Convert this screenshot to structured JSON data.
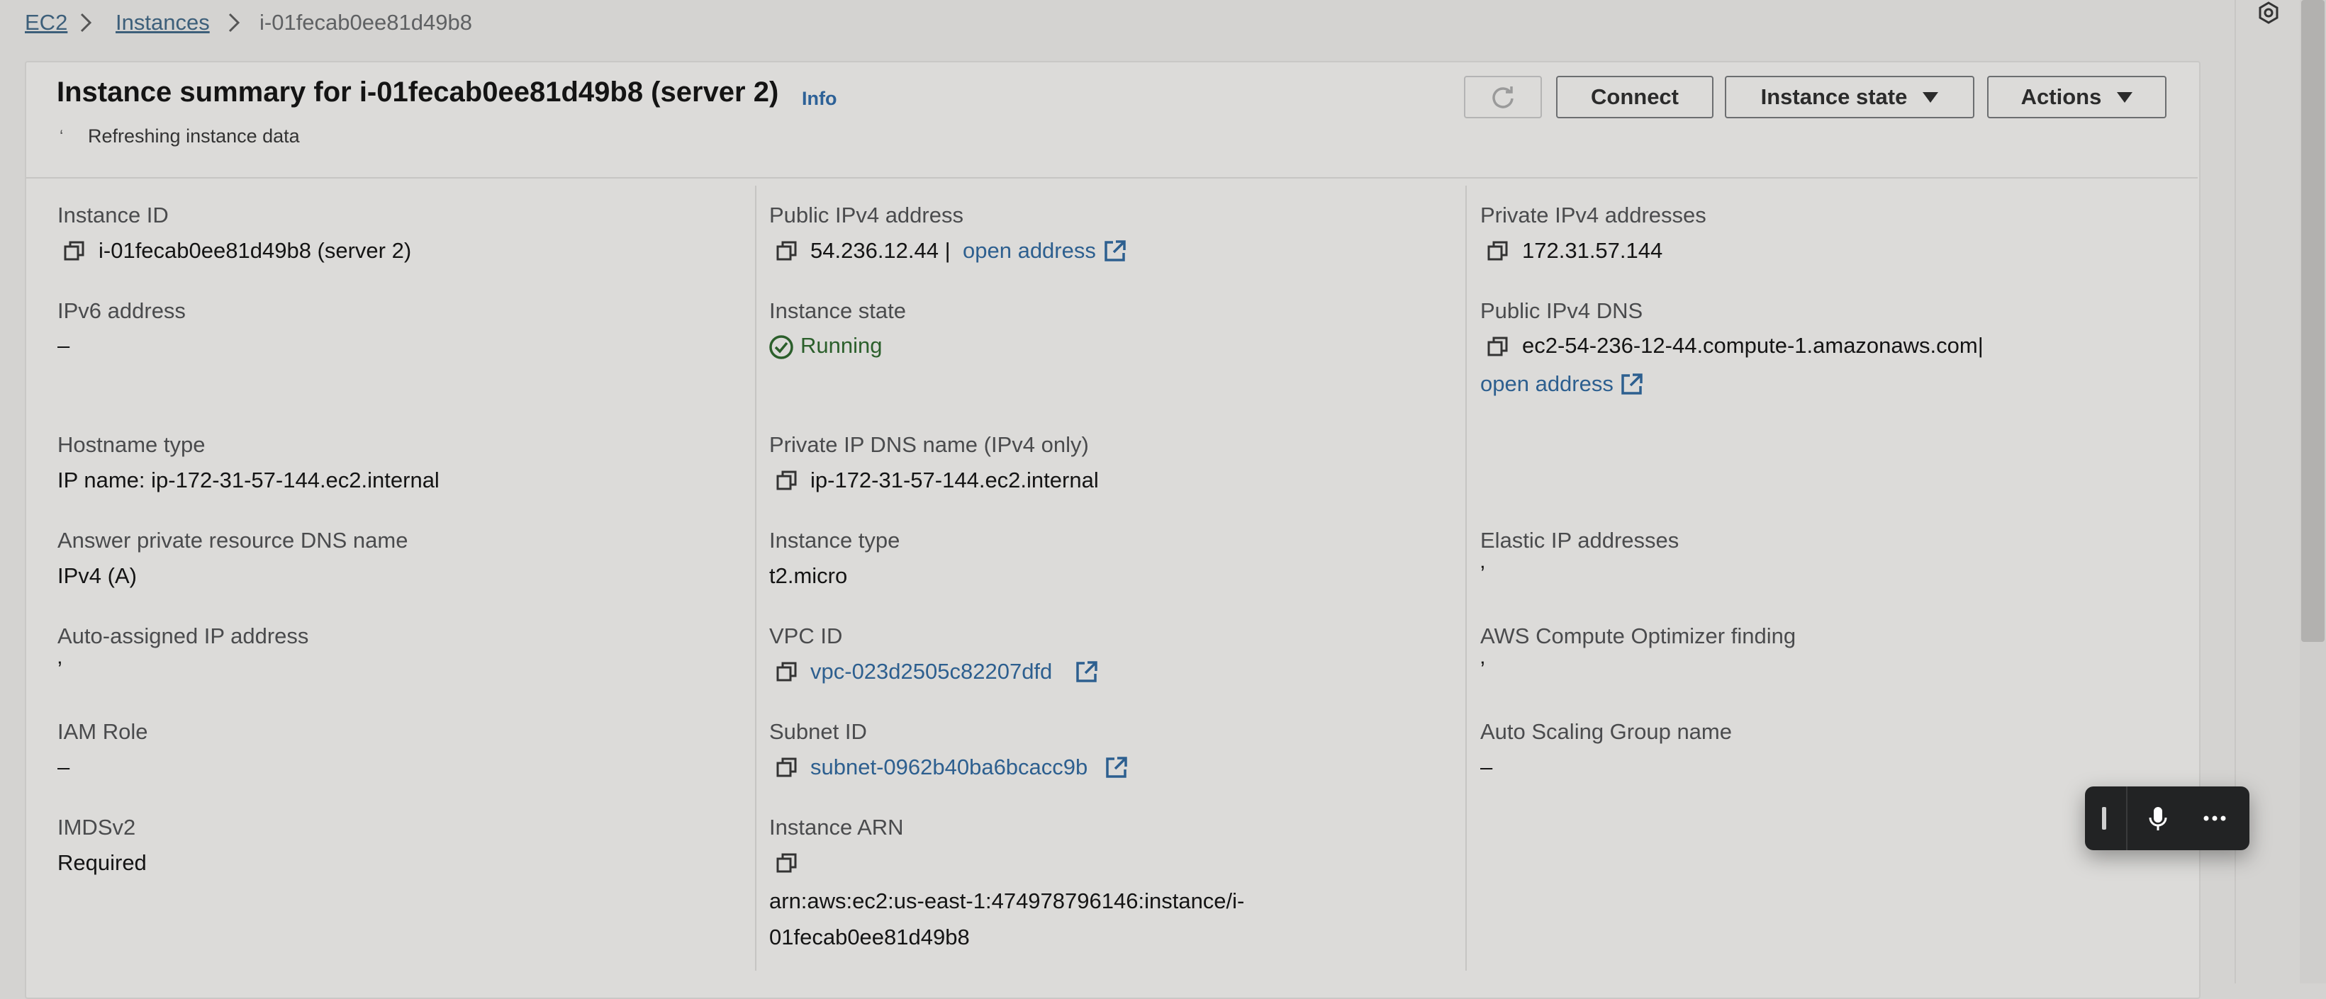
{
  "breadcrumb": {
    "ec2": "EC2",
    "instances": "Instances",
    "current": "i-01fecab0ee81d49b8"
  },
  "header": {
    "title": "Instance summary for i-01fecab0ee81d49b8 (server 2)",
    "info": "Info",
    "refresh_indicator": "ʻ",
    "refresh_status": "Refreshing instance data"
  },
  "buttons": {
    "connect": "Connect",
    "instance_state": "Instance state",
    "actions": "Actions"
  },
  "details": {
    "instance_id_label": "Instance ID",
    "instance_id": "i-01fecab0ee81d49b8 (server 2)",
    "ipv6_label": "IPv6 address",
    "ipv6": "–",
    "hostname_type_label": "Hostname type",
    "hostname_type": "IP name: ip-172-31-57-144.ec2.internal",
    "answer_dns_label": "Answer private resource DNS name",
    "answer_dns": "IPv4 (A)",
    "auto_ip_label": "Auto-assigned IP address",
    "auto_ip": "ʼ",
    "iam_role_label": "IAM Role",
    "iam_role": "–",
    "imdsv2_label": "IMDSv2",
    "imdsv2": "Required",
    "public_ipv4_label": "Public IPv4 address",
    "public_ipv4": "54.236.12.44 |",
    "public_ipv4_link": "open address",
    "instance_state_label": "Instance state",
    "instance_state": "Running",
    "private_dns_label": "Private IP DNS name (IPv4 only)",
    "private_dns": "ip-172-31-57-144.ec2.internal",
    "instance_type_label": "Instance type",
    "instance_type": "t2.micro",
    "vpc_id_label": "VPC ID",
    "vpc_id": "vpc-023d2505c82207dfd",
    "subnet_id_label": "Subnet ID",
    "subnet_id": "subnet-0962b40ba6bcacc9b",
    "arn_label": "Instance ARN",
    "arn_line1": "arn:aws:ec2:us-east-1:474978796146:instance/i-",
    "arn_line2": "01fecab0ee81d49b8",
    "private_ipv4_label": "Private IPv4 addresses",
    "private_ipv4": "172.31.57.144",
    "public_dns_label": "Public IPv4 DNS",
    "public_dns": "ec2-54-236-12-44.compute-1.amazonaws.com|",
    "public_dns_link": "open address",
    "elastic_ip_label": "Elastic IP addresses",
    "elastic_ip": "ʼ",
    "optimizer_label": "AWS Compute Optimizer finding",
    "optimizer": "ʼ",
    "asg_label": "Auto Scaling Group name",
    "asg": "–"
  },
  "icons": {
    "copy": "copy-icon",
    "external": "external-link-icon",
    "running": "check-circle-icon",
    "refresh": "refresh-icon",
    "mic": "microphone-icon",
    "more": "more-icon"
  },
  "colors": {
    "link": "#2d5f8f",
    "running": "#2b5f2b"
  }
}
